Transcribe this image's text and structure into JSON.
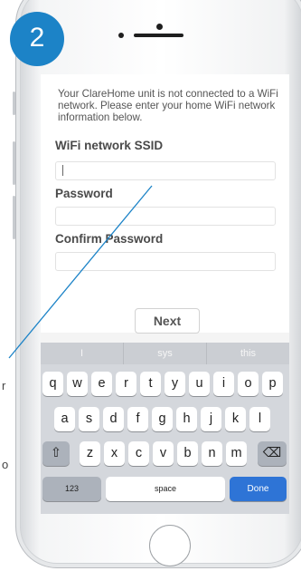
{
  "step_badge": "2",
  "intro_text": "Your ClareHome unit is not connected to a WiFi network. Please enter your home WiFi network information below.",
  "fields": [
    {
      "label": "WiFi network SSID",
      "value": ""
    },
    {
      "label": "Password",
      "value": ""
    },
    {
      "label": "Confirm Password",
      "value": ""
    }
  ],
  "next_label": "Next",
  "suggestions": [
    "I",
    "sys",
    "this"
  ],
  "keyboard": {
    "row1": [
      "q",
      "w",
      "e",
      "r",
      "t",
      "y",
      "u",
      "i",
      "o",
      "p"
    ],
    "row2": [
      "a",
      "s",
      "d",
      "f",
      "g",
      "h",
      "j",
      "k",
      "l"
    ],
    "row3": [
      "z",
      "x",
      "c",
      "v",
      "b",
      "n",
      "m"
    ],
    "shift_symbol": "⇧",
    "delete_symbol": "⌫",
    "numbers_label": "123",
    "space_label": "space",
    "done_label": "Done"
  },
  "edge_fragments": [
    "r",
    "o"
  ]
}
